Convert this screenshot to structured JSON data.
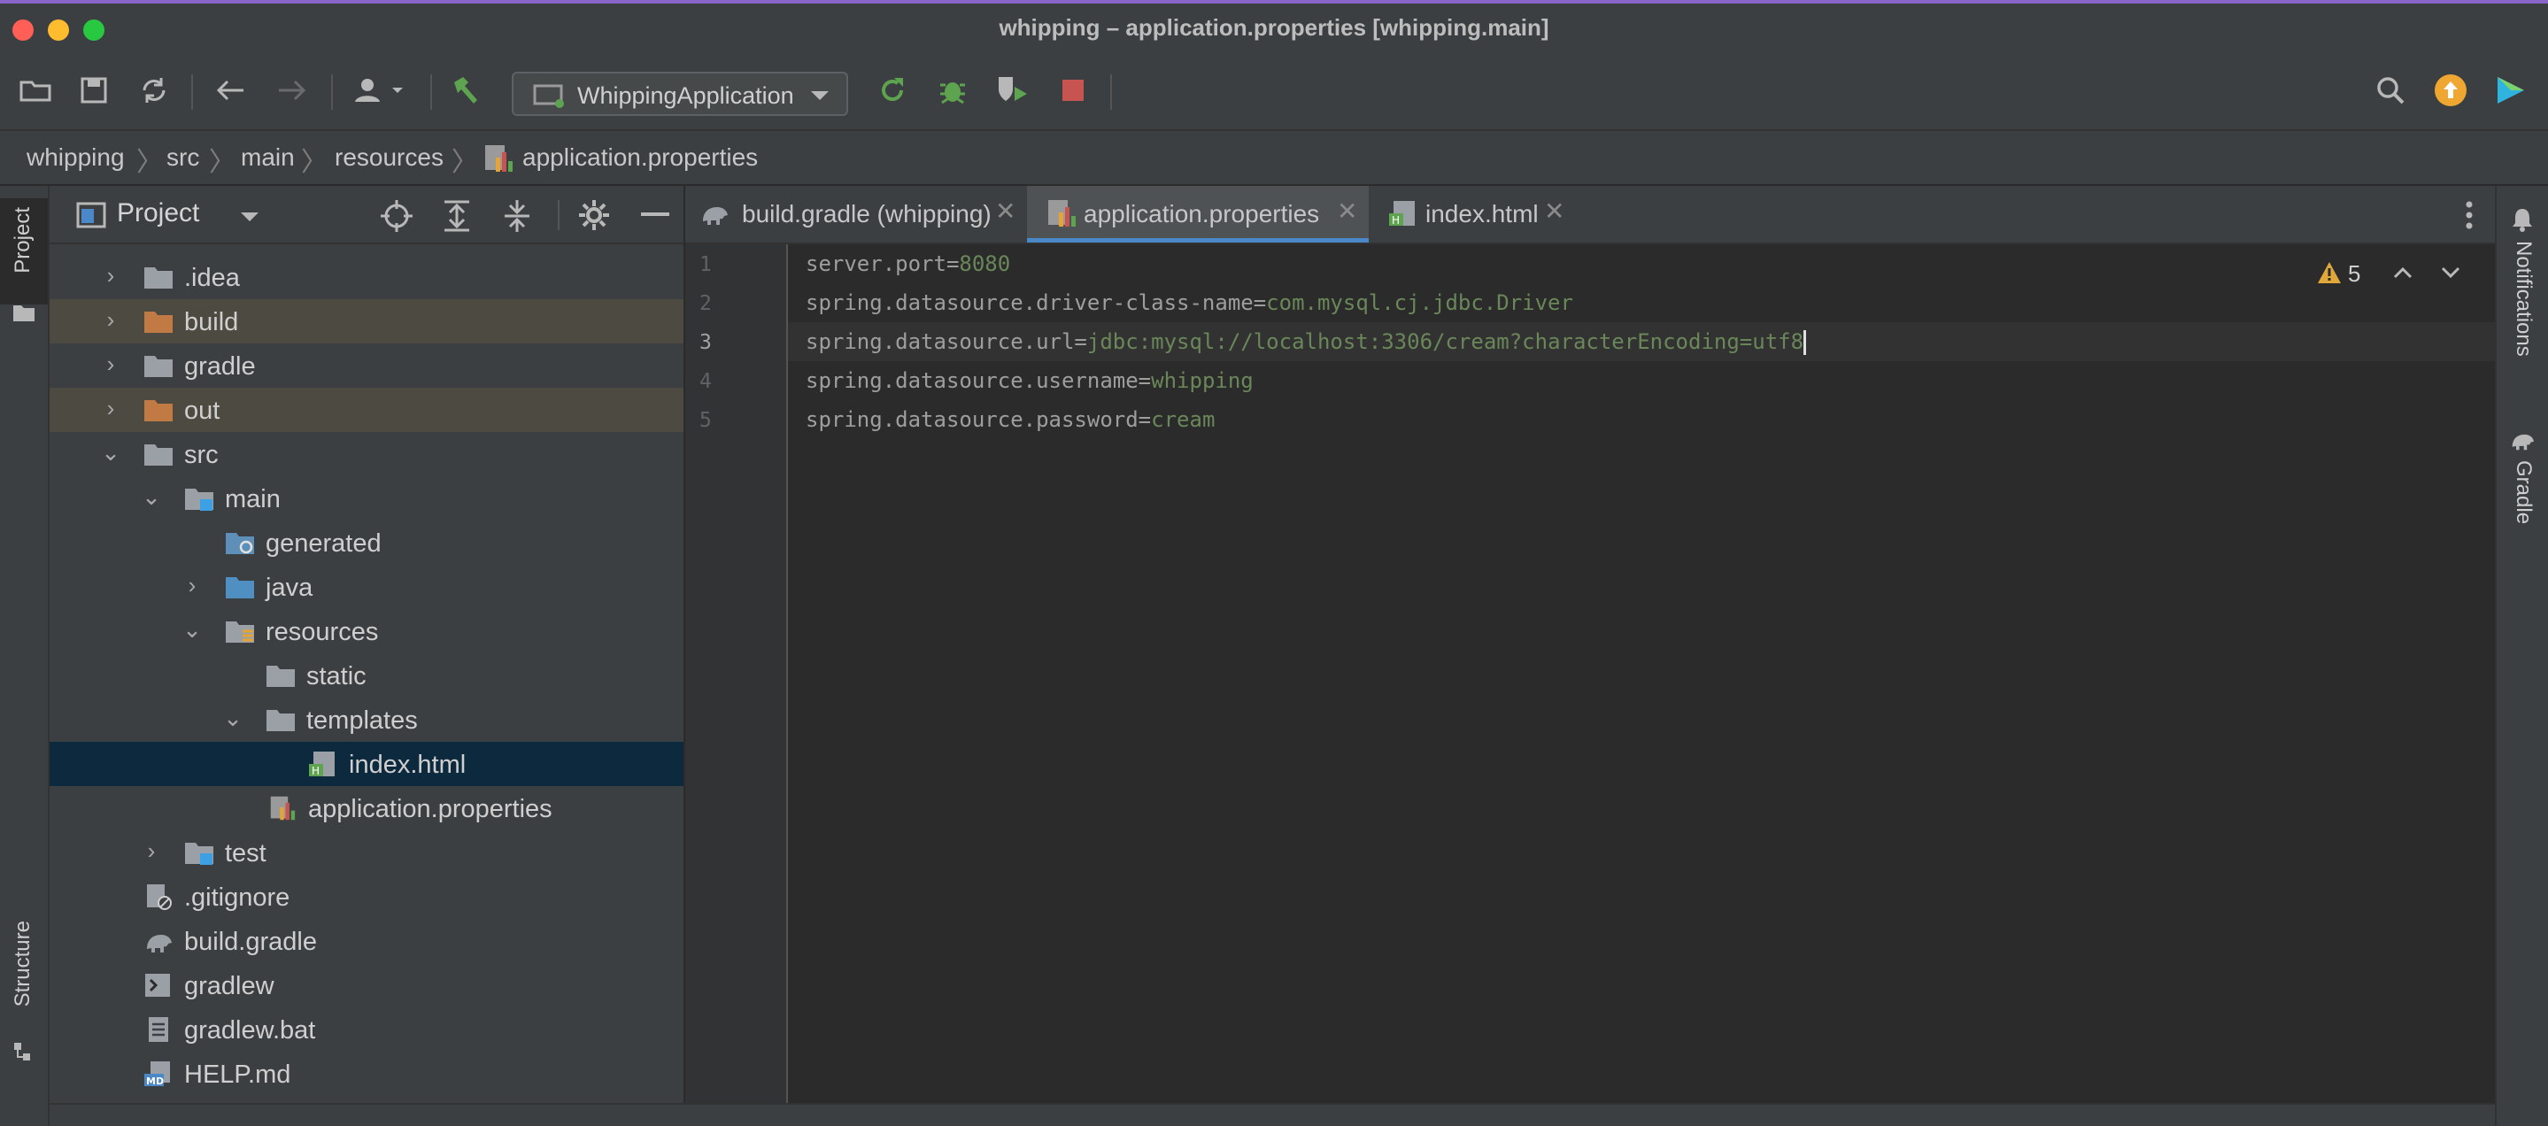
{
  "window": {
    "title": "whipping – application.properties [whipping.main]"
  },
  "toolbar": {
    "run_config": "WhippingApplication",
    "icons": [
      "open-folder-icon",
      "save-icon",
      "sync-icon",
      "back-icon",
      "forward-icon",
      "user-icon",
      "build-hammer-icon",
      "rerun-icon",
      "debug-icon",
      "coverage-icon",
      "stop-icon",
      "search-icon",
      "update-icon",
      "plugin-icon"
    ]
  },
  "breadcrumb": [
    "whipping",
    "src",
    "main",
    "resources",
    "application.properties"
  ],
  "left_strip": {
    "project": "Project",
    "structure": "Structure"
  },
  "right_strip": {
    "notifications": "Notifications",
    "gradle": "Gradle"
  },
  "project_panel": {
    "title": "Project",
    "tree": [
      {
        "label": ".idea"
      },
      {
        "label": "build"
      },
      {
        "label": "gradle"
      },
      {
        "label": "out"
      },
      {
        "label": "src"
      },
      {
        "label": "main"
      },
      {
        "label": "generated"
      },
      {
        "label": "java"
      },
      {
        "label": "resources"
      },
      {
        "label": "static"
      },
      {
        "label": "templates"
      },
      {
        "label": "index.html"
      },
      {
        "label": "application.properties"
      },
      {
        "label": "test"
      },
      {
        "label": ".gitignore"
      },
      {
        "label": "build.gradle"
      },
      {
        "label": "gradlew"
      },
      {
        "label": "gradlew.bat"
      },
      {
        "label": "HELP.md"
      }
    ]
  },
  "editor": {
    "tabs": [
      {
        "label": "build.gradle (whipping)"
      },
      {
        "label": "application.properties",
        "active": true
      },
      {
        "label": "index.html"
      }
    ],
    "warnings": "5",
    "lines": [
      {
        "num": "1",
        "key": "server.port=",
        "value": "8080"
      },
      {
        "num": "2",
        "key": "spring.datasource.driver-class-name=",
        "value": "com.mysql.cj.jdbc.Driver"
      },
      {
        "num": "3",
        "key": "spring.datasource.url=",
        "value": "jdbc:mysql://localhost:3306/cream?characterEncoding=utf8"
      },
      {
        "num": "4",
        "key": "spring.datasource.username=",
        "value": "whipping"
      },
      {
        "num": "5",
        "key": "spring.datasource.password=",
        "value": "cream"
      }
    ]
  },
  "colors": {
    "accent": "#4a88c7",
    "string_value": "#6a8759",
    "selection": "#0d293e",
    "excluded_folder": "#d7a06b"
  }
}
